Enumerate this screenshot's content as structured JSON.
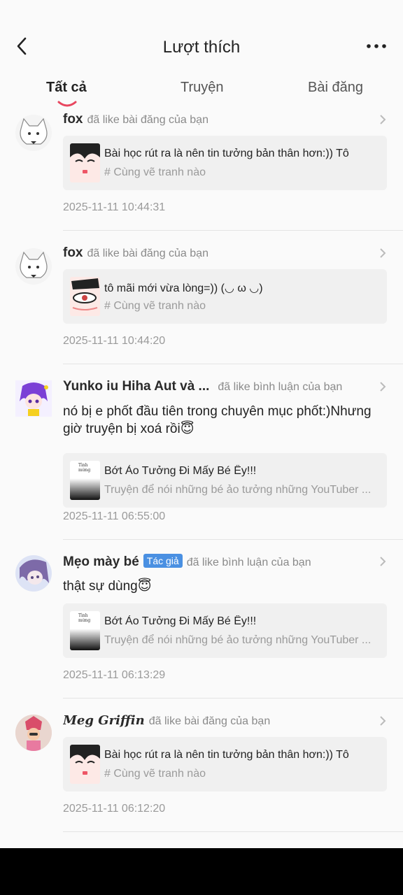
{
  "header": {
    "title": "Lượt thích"
  },
  "tabs": [
    {
      "label": "Tất cả",
      "active": true
    },
    {
      "label": "Truyện",
      "active": false
    },
    {
      "label": "Bài đăng",
      "active": false
    }
  ],
  "colors": {
    "accent": "#e8475f",
    "badge": "#4a90e2"
  },
  "items": [
    {
      "user": "fox",
      "action": "đã like bài đăng của bạn",
      "card_title": "Bài học rút ra là nên tin tưởng bản thân hơn:)) Tô",
      "card_sub": "# Cùng vẽ tranh nào",
      "time": "2025-11-11 10:44:31"
    },
    {
      "user": "fox",
      "action": "đã like bài đăng của bạn",
      "card_title": "tô mãi mới vừa lòng=)) (◡ ω ◡)",
      "card_sub": "# Cùng vẽ tranh nào",
      "time": "2025-11-11 10:44:20"
    },
    {
      "user": "Yunko iu Hiha Aut và ...",
      "action": "đã like bình luận của bạn",
      "comment": "nó bị e phốt đầu tiên trong chuyên mục phốt:)Nhưng giờ truyện bị xoá rồi😇",
      "card_title": "Bớt Ảo Tưởng Đi Mấy Bé Êy!!!",
      "card_sub": "Truyện để nói những bé ảo tưởng những YouTuber ...",
      "thumb_text": "Tình mừng",
      "time": "2025-11-11 06:55:00"
    },
    {
      "user": "Mẹo mày bé",
      "badge": "Tác giả",
      "action": "đã like bình luận của bạn",
      "comment": "thật sự dùng😇",
      "card_title": "Bớt Ảo Tưởng Đi Mấy Bé Êy!!!",
      "card_sub": "Truyện để nói những bé ảo tưởng những YouTuber ...",
      "thumb_text": "Tình mừng",
      "time": "2025-11-11 06:13:29"
    },
    {
      "user": "Meg Griffin",
      "action": "đã like bài đăng của bạn",
      "card_title": "Bài học rút ra là nên tin tưởng bản thân hơn:)) Tô",
      "card_sub": "# Cùng vẽ tranh nào",
      "time": "2025-11-11 06:12:20"
    }
  ]
}
